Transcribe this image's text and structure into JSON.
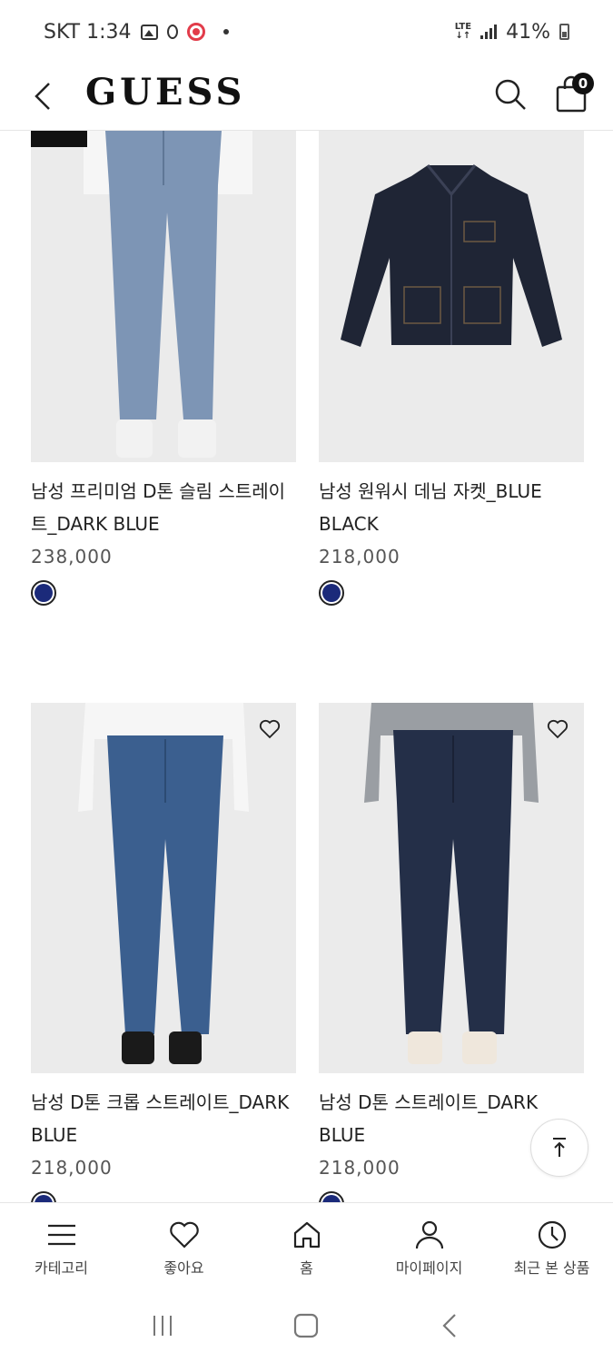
{
  "status_bar": {
    "carrier_time": "SKT 1:34",
    "network": "LTE",
    "battery": "41%"
  },
  "header": {
    "logo": "GUESS",
    "cart_count": "0"
  },
  "products": [
    {
      "name": "남성 프리미엄 D톤 슬림 스트레이트_DARK BLUE",
      "price": "238,000",
      "swatch_color": "#1b2a7a",
      "image": "light-wash-jeans"
    },
    {
      "name": "남성 원워시 데님 자켓_BLUE BLACK",
      "price": "218,000",
      "swatch_color": "#1b2a7a",
      "image": "denim-jacket"
    },
    {
      "name": "남성 D톤 크롭 스트레이트_DARK BLUE",
      "price": "218,000",
      "swatch_color": "#1b2a7a",
      "image": "mid-wash-jeans"
    },
    {
      "name": "남성 D톤 스트레이트_DARK BLUE",
      "price": "218,000",
      "swatch_color": "#1b2a7a",
      "image": "dark-wash-jeans"
    }
  ],
  "bottom_nav": [
    {
      "label": "카테고리",
      "icon": "menu-icon"
    },
    {
      "label": "좋아요",
      "icon": "heart-icon"
    },
    {
      "label": "홈",
      "icon": "home-icon"
    },
    {
      "label": "마이페이지",
      "icon": "user-icon"
    },
    {
      "label": "최근 본 상품",
      "icon": "clock-icon"
    }
  ]
}
